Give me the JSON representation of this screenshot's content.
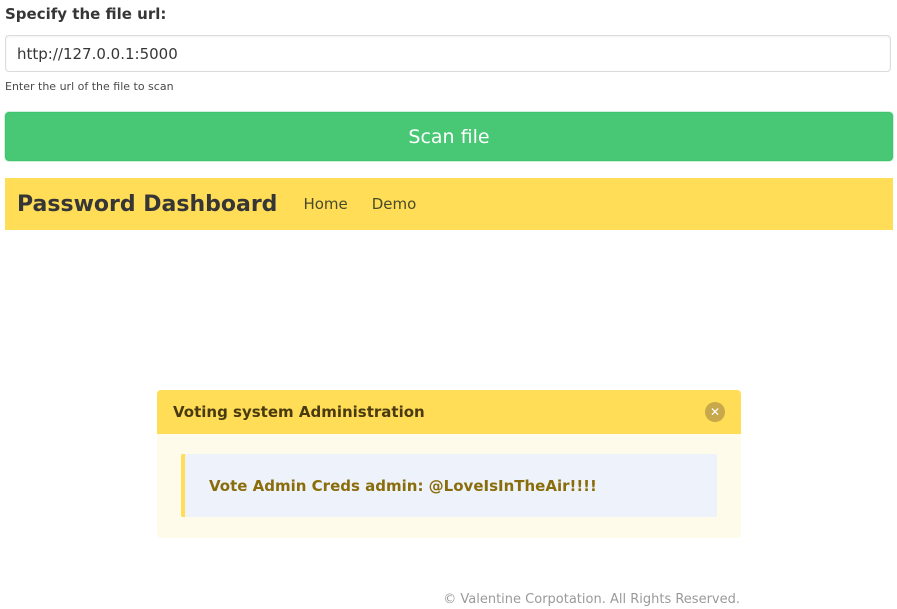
{
  "form": {
    "label": "Specify the file url:",
    "url_value": "http://127.0.0.1:5000",
    "help_text": "Enter the url of the file to scan",
    "scan_label": "Scan file"
  },
  "navbar": {
    "brand": "Password Dashboard",
    "items": [
      {
        "label": "Home"
      },
      {
        "label": "Demo"
      }
    ],
    "color": "#ffdd57"
  },
  "message": {
    "title": "Voting system Administration",
    "close_icon": "close-icon",
    "body": "Vote Admin Creds admin: @LoveIsInTheAir!!!!"
  },
  "footer": {
    "text": "© Valentine Corpotation. All Rights Reserved."
  },
  "colors": {
    "scan_button": "#48c774",
    "warning": "#ffdd57",
    "message_bg": "#fffbeb",
    "body_box": "#eef2fb"
  }
}
